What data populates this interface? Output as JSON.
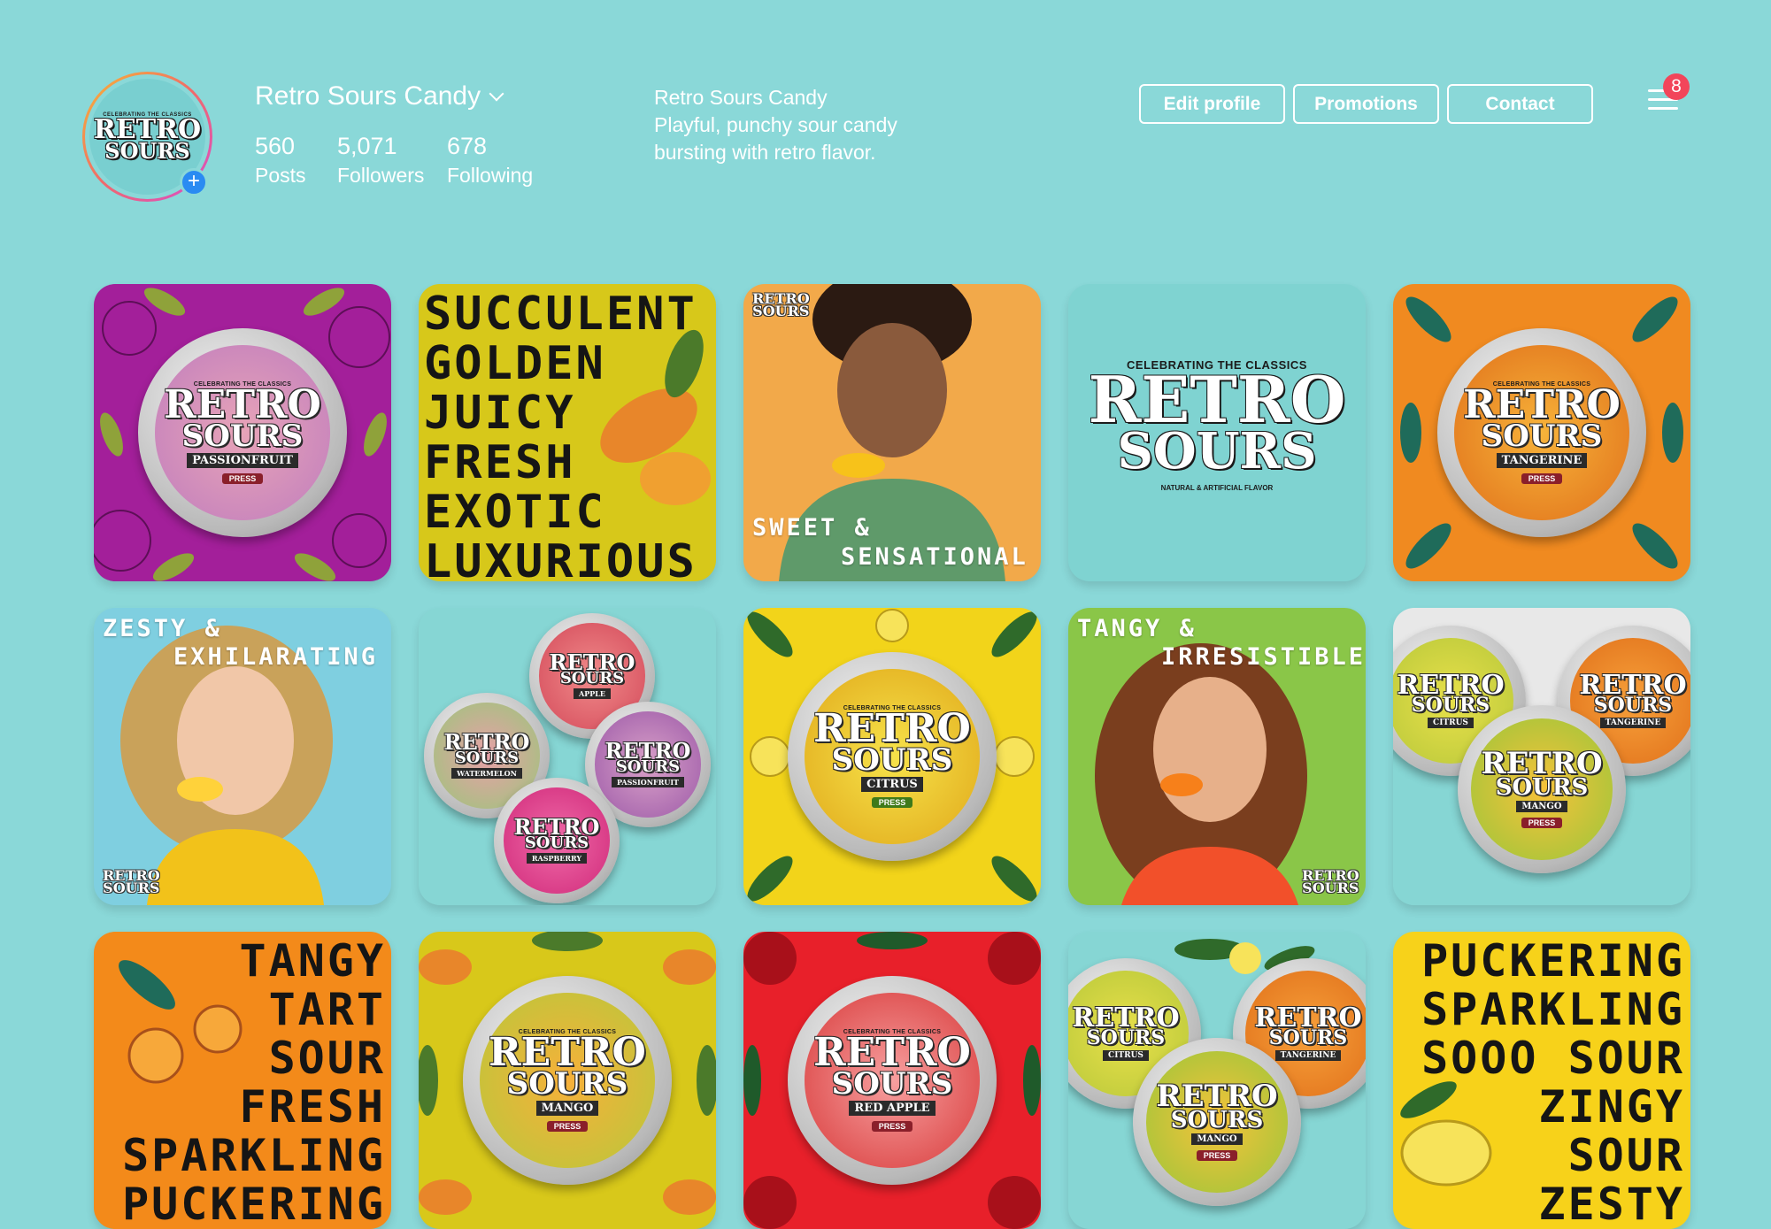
{
  "profile": {
    "username": "Retro Sours Candy",
    "avatar_logo": {
      "top": "CELEBRATING THE CLASSICS",
      "word1": "RETRO",
      "word2": "SOURS"
    },
    "stats": [
      {
        "value": "560",
        "label": "Posts"
      },
      {
        "value": "5,071",
        "label": "Followers"
      },
      {
        "value": "678",
        "label": "Following"
      }
    ],
    "bio": {
      "name": "Retro Sours Candy",
      "line1": "Playful, punchy sour candy",
      "line2": "bursting with retro flavor."
    }
  },
  "actions": {
    "edit_profile": "Edit profile",
    "promotions": "Promotions",
    "contact": "Contact"
  },
  "notifications": {
    "count": "8"
  },
  "colors": {
    "background": "#8ad8d8",
    "badge": "#f2455a",
    "plus": "#2a8bf2"
  },
  "brand": {
    "celebrating": "CELEBRATING THE CLASSICS",
    "word1": "RETRO",
    "word2": "SOURS",
    "natural": "NATURAL & ARTIFICIAL FLAVOR",
    "press": "PRESS"
  },
  "posts": {
    "p1": {
      "flavor": "PASSIONFRUIT"
    },
    "p2": {
      "lines": [
        "SUCCULENT",
        "GOLDEN",
        "JUICY",
        "FRESH",
        "EXOTIC",
        "LUXURIOUS"
      ]
    },
    "p3": {
      "line1": "SWEET &",
      "line2": "SENSATIONAL"
    },
    "p5": {
      "flavor": "TANGERINE"
    },
    "p6": {
      "line1": "ZESTY &",
      "line2": "EXHILARATING"
    },
    "p7": {
      "flavors": [
        "APPLE",
        "WATERMELON",
        "PASSIONFRUIT",
        "RASPBERRY"
      ]
    },
    "p8": {
      "flavor": "CITRUS"
    },
    "p9": {
      "line1": "TANGY &",
      "line2": "IRRESISTIBLE"
    },
    "p10": {
      "flavors": [
        "CITRUS",
        "TANGERINE",
        "MANGO"
      ]
    },
    "p11": {
      "lines": [
        "TANGY",
        "TART",
        "SOUR",
        "FRESH",
        "SPARKLING",
        "PUCKERING"
      ]
    },
    "p12": {
      "flavor": "MANGO"
    },
    "p13": {
      "flavor": "RED APPLE"
    },
    "p14": {
      "flavors": [
        "CITRUS",
        "TANGERINE",
        "MANGO"
      ]
    },
    "p15": {
      "lines": [
        "PUCKERING",
        "SPARKLING",
        "SOOO SOUR",
        "ZINGY",
        "SOUR",
        "ZESTY"
      ]
    }
  }
}
